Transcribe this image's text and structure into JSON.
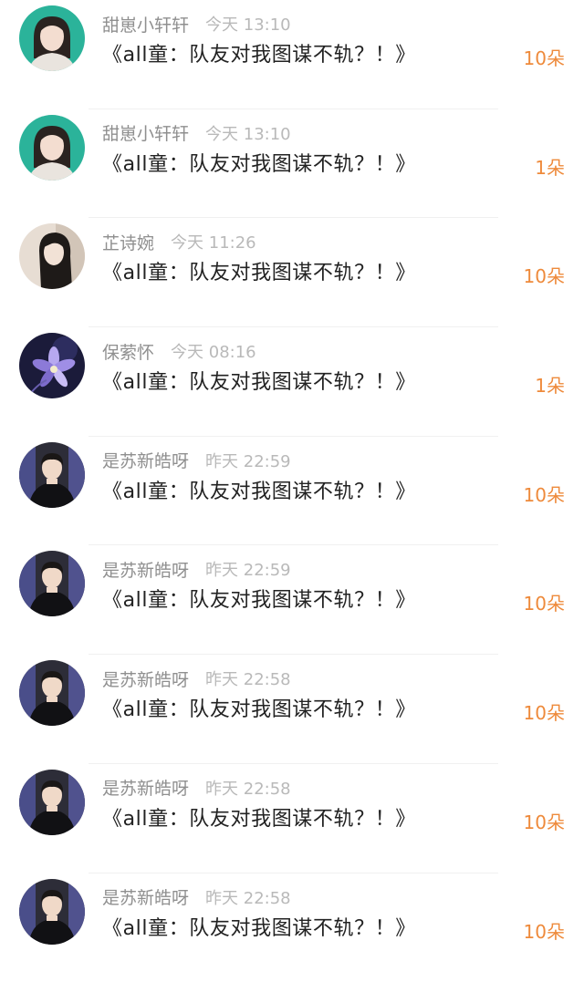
{
  "accent_color": "#ee8a3b",
  "comments": [
    {
      "username": "甜崽小轩轩",
      "time": "今天 13:10",
      "message": "《all童：队友对我图谋不轨？！》",
      "gift": "10朵",
      "avatar": "girl-teal-bg"
    },
    {
      "username": "甜崽小轩轩",
      "time": "今天 13:10",
      "message": "《all童：队友对我图谋不轨？！》",
      "gift": "1朵",
      "avatar": "girl-teal-bg"
    },
    {
      "username": "芷诗婉",
      "time": "今天 11:26",
      "message": "《all童：队友对我图谋不轨？！》",
      "gift": "10朵",
      "avatar": "girl-long-hair"
    },
    {
      "username": "保萦怀",
      "time": "今天 08:16",
      "message": "《all童：队友对我图谋不轨？！》",
      "gift": "1朵",
      "avatar": "purple-flower"
    },
    {
      "username": "是苏新皓呀",
      "time": "昨天 22:59",
      "message": "《all童：队友对我图谋不轨？！》",
      "gift": "10朵",
      "avatar": "boy-dark"
    },
    {
      "username": "是苏新皓呀",
      "time": "昨天 22:59",
      "message": "《all童：队友对我图谋不轨？！》",
      "gift": "10朵",
      "avatar": "boy-dark"
    },
    {
      "username": "是苏新皓呀",
      "time": "昨天 22:58",
      "message": "《all童：队友对我图谋不轨？！》",
      "gift": "10朵",
      "avatar": "boy-dark"
    },
    {
      "username": "是苏新皓呀",
      "time": "昨天 22:58",
      "message": "《all童：队友对我图谋不轨？！》",
      "gift": "10朵",
      "avatar": "boy-dark"
    },
    {
      "username": "是苏新皓呀",
      "time": "昨天 22:58",
      "message": "《all童：队友对我图谋不轨？！》",
      "gift": "10朵",
      "avatar": "boy-dark"
    }
  ]
}
